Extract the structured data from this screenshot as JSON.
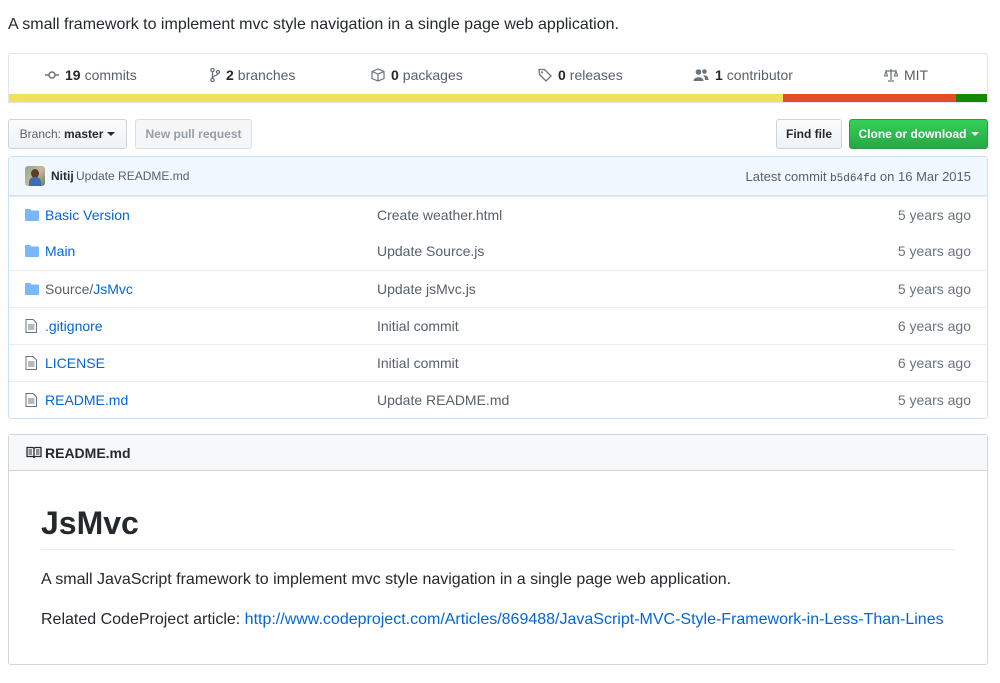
{
  "description": "A small framework to implement mvc style navigation in a single page web application.",
  "stats": {
    "commits_count": "19",
    "commits_label": "commits",
    "branches_count": "2",
    "branches_label": "branches",
    "packages_count": "0",
    "packages_label": "packages",
    "releases_count": "0",
    "releases_label": "releases",
    "contributors_count": "1",
    "contributors_label": "contributor",
    "license": "MIT"
  },
  "language_bar": [
    {
      "color": "#f1e05a",
      "fraction": 0.791
    },
    {
      "color": "#e34c26",
      "fraction": 0.177
    },
    {
      "color": "#178600",
      "fraction": 0.032
    }
  ],
  "toolbar": {
    "branch_label": "Branch:",
    "branch_name": "master",
    "new_pr": "New pull request",
    "find_file": "Find file",
    "clone": "Clone or download"
  },
  "commit": {
    "author": "Nitij",
    "message": "Update README.md",
    "latest_label": "Latest commit",
    "sha": "b5d64fd",
    "date": "on 16 Mar 2015"
  },
  "files": [
    {
      "type": "folder",
      "name": "Basic Version",
      "message": "Create weather.html",
      "age": "5 years ago"
    },
    {
      "type": "folder",
      "name": "Main",
      "message": "Update Source.js",
      "age": "5 years ago"
    },
    {
      "type": "folder",
      "prefix": "Source/",
      "name": "JsMvc",
      "message": "Update jsMvc.js",
      "age": "5 years ago"
    },
    {
      "type": "file",
      "name": ".gitignore",
      "message": "Initial commit",
      "age": "6 years ago"
    },
    {
      "type": "file",
      "name": "LICENSE",
      "message": "Initial commit",
      "age": "6 years ago"
    },
    {
      "type": "file",
      "name": "README.md",
      "message": "Update README.md",
      "age": "5 years ago"
    }
  ],
  "readme": {
    "header": "README.md",
    "h1": "JsMvc",
    "paragraph": "A small JavaScript framework to implement mvc style navigation in a single page web application.",
    "related_label": "Related CodeProject article:",
    "related_link": "http://www.codeproject.com/Articles/869488/JavaScript-MVC-Style-Framework-in-Less-Than-Lines"
  }
}
